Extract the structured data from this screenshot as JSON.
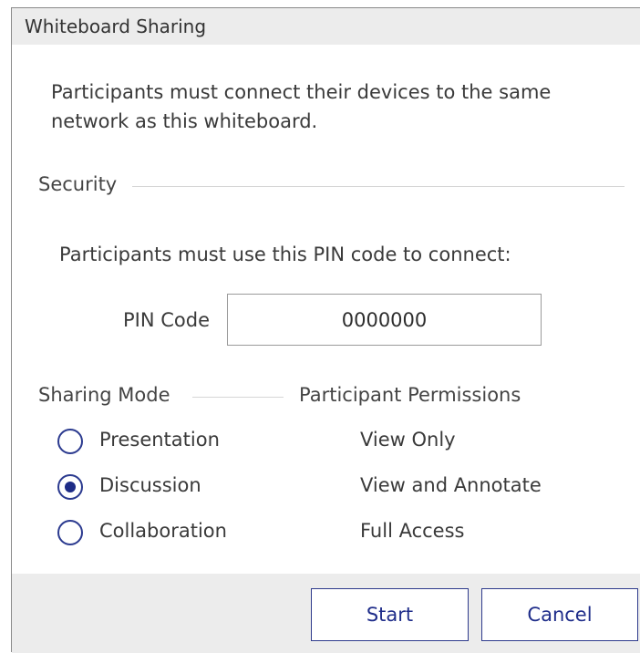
{
  "dialog": {
    "title": "Whiteboard Sharing",
    "description": "Participants must connect their devices to the same network as this whiteboard."
  },
  "security": {
    "section_label": "Security",
    "pin_instruction": "Participants must use this PIN code to connect:",
    "pin_label": "PIN Code",
    "pin_value": "0000000"
  },
  "sharing": {
    "mode_header": "Sharing Mode",
    "permissions_header": "Participant Permissions",
    "selected": "Discussion",
    "options": [
      {
        "mode": "Presentation",
        "permission": "View Only",
        "selected": false
      },
      {
        "mode": "Discussion",
        "permission": "View and Annotate",
        "selected": true
      },
      {
        "mode": "Collaboration",
        "permission": "Full Access",
        "selected": false
      }
    ]
  },
  "buttons": {
    "start": "Start",
    "cancel": "Cancel"
  },
  "colors": {
    "accent": "#1f2d8a",
    "titlebar": "#ececec",
    "footer": "#ececec"
  }
}
